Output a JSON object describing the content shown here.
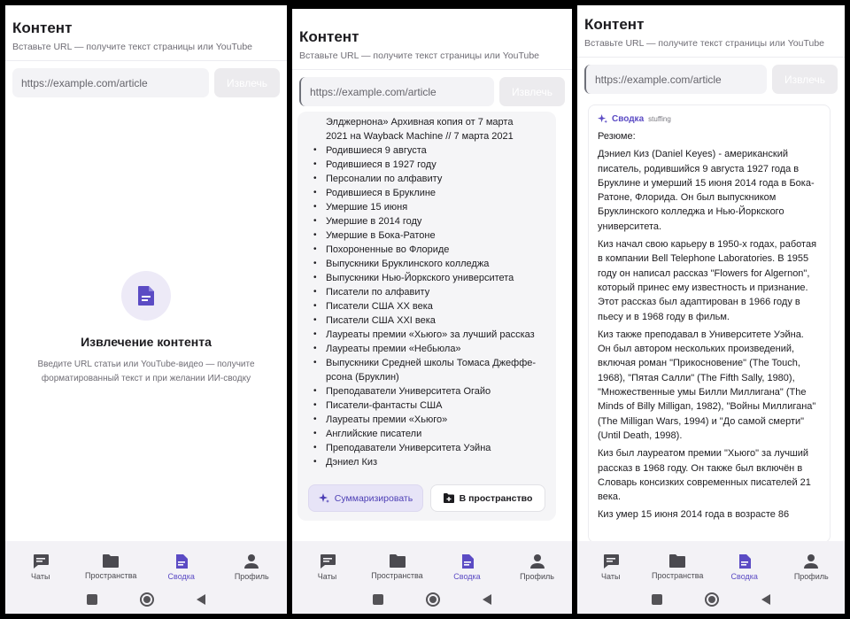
{
  "app": {
    "title": "Контент",
    "subtitle": "Вставьте URL — получите текст страницы или YouTube",
    "url_placeholder": "https://example.com/article",
    "extract_label": "Извлечь"
  },
  "empty_state": {
    "title": "Извлечение контента",
    "description": "Введите URL статьи или YouTube-видео — получите форматированный текст и при желании ИИ-сводку"
  },
  "nav": {
    "items": [
      {
        "label": "Чаты",
        "icon": "chat-icon"
      },
      {
        "label": "Пространства",
        "icon": "folder-icon"
      },
      {
        "label": "Сводка",
        "icon": "document-icon",
        "active": true
      },
      {
        "label": "Профиль",
        "icon": "person-icon"
      }
    ]
  },
  "extracted": {
    "lead_lines": [
      "Элджернона» Архивная копия от 7 марта",
      "2021 на Wayback Machine // 7 марта 2021"
    ],
    "categories": [
      "Родившиеся 9 августа",
      "Родившиеся в 1927 году",
      "Персоналии по алфавиту",
      "Родившиеся в Бруклине",
      "Умершие 15 июня",
      "Умершие в 2014 году",
      "Умершие в Бока-Ратоне",
      "Похороненные во Флориде",
      "Выпускники Бруклинского колледжа",
      "Выпускники Нью-Йоркского университета",
      "Писатели по алфавиту",
      "Писатели США XX века",
      "Писатели США XXI века",
      "Лауреаты премии «Хьюго» за лучший рассказ",
      "Лауреаты премии «Небьюла»",
      "Выпускники Средней школы Томаса Джеффе­рсона (Бруклин)",
      "Преподаватели Университета Огайо",
      "Писатели-фантасты США",
      "Лауреаты премии «Хьюго»",
      "Английские писатели",
      "Преподаватели Университета Уэйна",
      "Дэниел Киз"
    ],
    "summarize_label": "Суммаризировать",
    "to_space_label": "В пространство"
  },
  "summary": {
    "title": "Сводка",
    "tag": "stuffing",
    "heading": "Резюме:",
    "paragraphs": [
      "Дэниел Киз (Daniel Keyes) - американский писатель, родившийся 9 августа 1927 года в Бруклине и умерший 15 июня 2014 года в Бока-Ратоне, Флорида. Он был выпускником Бруклинского колледжа и Нью-Йоркского университета.",
      "Киз начал свою карьеру в 1950-х годах, работая в компании Bell Telephone Laboratories. В 1955 году он написал рассказ \"Flowers for Algernon\", который принес ему известность и признание. Этот рассказ был адаптирован в 1966 году в пьесу и в 1968 году в фильм.",
      "Киз также преподавал в Университете Уэйна. Он был автором нескольких произведений, включая роман \"Прикосновение\" (The Touch, 1968), \"Пятая Салли\" (The Fifth Sally, 1980), \"Множественные умы Билли Миллигана\" (The Minds of Billy Milligan, 1982), \"Войны Миллигана\" (The Milligan Wars, 1994) и \"До самой смерти\" (Until Death, 1998).",
      "Киз был лауреатом премии \"Хьюго\" за лучший рассказ в 1968 году. Он также был включён в Словарь консизких современных писателей 21 века.",
      "Киз умер 15 июня 2014 года в возрасте 86"
    ]
  },
  "colors": {
    "accent": "#5b4bc4",
    "accent_soft": "#edeaf7",
    "nav_bg": "#f3f2f6"
  }
}
